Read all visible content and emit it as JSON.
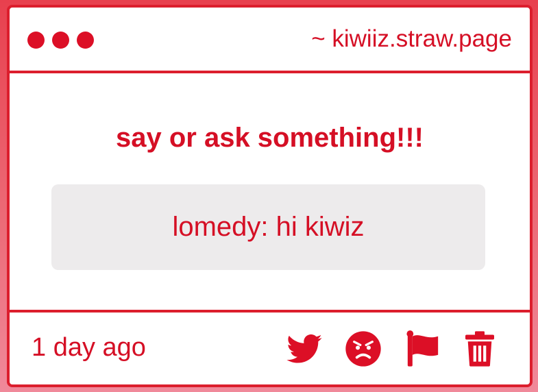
{
  "window": {
    "site_label": "~ kiwiiz.straw.page"
  },
  "main": {
    "prompt": "say or ask something!!!",
    "message": "lomedy: hi kiwiz"
  },
  "footer": {
    "timestamp": "1 day ago",
    "actions": [
      {
        "icon": "twitter-icon"
      },
      {
        "icon": "angry-face-icon"
      },
      {
        "icon": "flag-icon"
      },
      {
        "icon": "trash-icon"
      }
    ]
  },
  "colors": {
    "accent": "#dc0f26",
    "message_bg": "#edebec",
    "background": "#e8404e"
  }
}
